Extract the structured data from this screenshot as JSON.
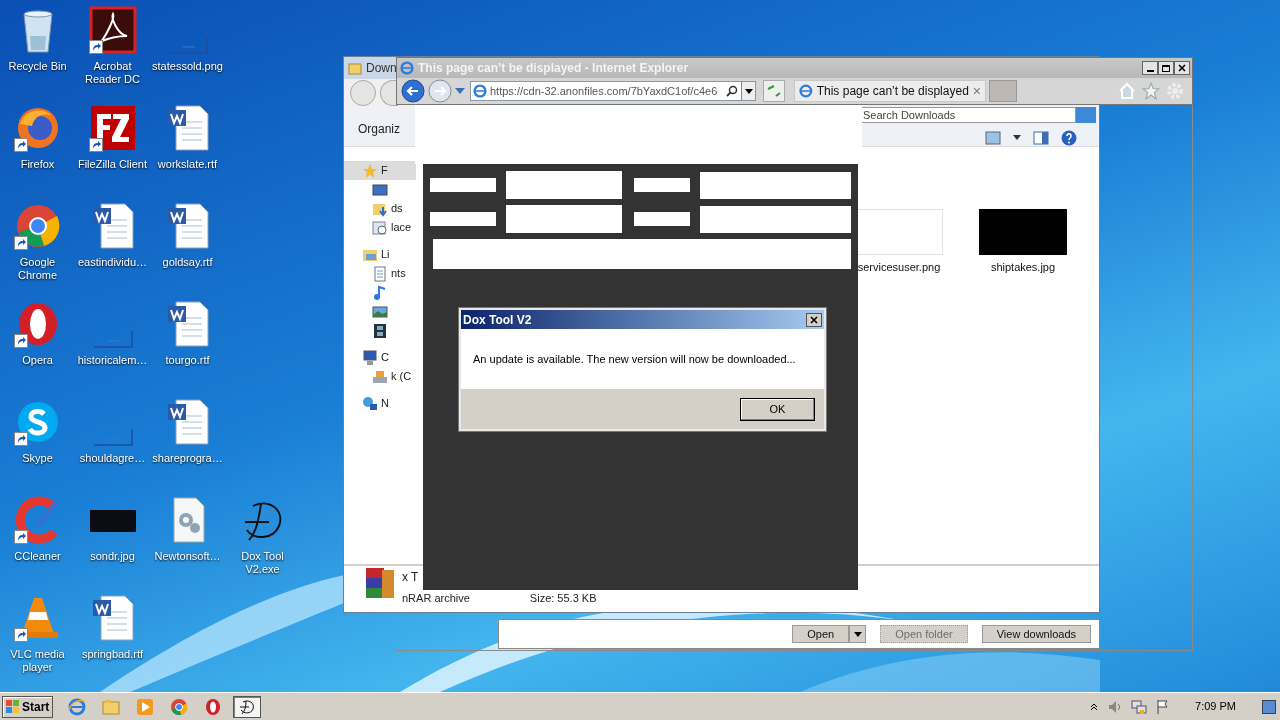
{
  "desktop_columns": [
    [
      {
        "label": "Recycle Bin",
        "kind": "recycle",
        "shortcut": false
      },
      {
        "label": "Firefox",
        "kind": "firefox",
        "shortcut": true
      },
      {
        "label": "Google Chrome",
        "kind": "chrome",
        "shortcut": true
      },
      {
        "label": "Opera",
        "kind": "opera",
        "shortcut": true
      },
      {
        "label": "Skype",
        "kind": "skype",
        "shortcut": true
      },
      {
        "label": "CCleaner",
        "kind": "ccleaner",
        "shortcut": true
      },
      {
        "label": "VLC media player",
        "kind": "vlc",
        "shortcut": true
      }
    ],
    [
      {
        "label": "Acrobat Reader DC",
        "kind": "acrobat",
        "shortcut": true
      },
      {
        "label": "FileZilla Client",
        "kind": "filezilla",
        "shortcut": true
      },
      {
        "label": "eastindividu…",
        "kind": "word",
        "shortcut": false
      },
      {
        "label": "historicalem…",
        "kind": "blank-image",
        "shortcut": false
      },
      {
        "label": "shouldagre…",
        "kind": "blank-image",
        "shortcut": false
      },
      {
        "label": "sondr.jpg",
        "kind": "dark-image",
        "shortcut": false
      },
      {
        "label": "springbad.rtf",
        "kind": "word",
        "shortcut": false
      }
    ],
    [
      {
        "label": "statessold.png",
        "kind": "blank-image",
        "shortcut": false
      },
      {
        "label": "workslate.rtf",
        "kind": "word",
        "shortcut": false
      },
      {
        "label": "goldsay.rtf",
        "kind": "word",
        "shortcut": false
      },
      {
        "label": "tourgo.rtf",
        "kind": "word",
        "shortcut": false
      },
      {
        "label": "shareprogra…",
        "kind": "word",
        "shortcut": false
      },
      {
        "label": "Newtonsoft…",
        "kind": "settings-file",
        "shortcut": false
      }
    ],
    [
      {
        "label": "Dox Tool V2.exe",
        "kind": "dox",
        "shortcut": false
      }
    ]
  ],
  "explorer": {
    "title": "Down",
    "toolbar_label": "Organiz",
    "search_placeholder": "Search Downloads",
    "nav": [
      {
        "label": "F",
        "kind": "star",
        "selected": true,
        "children": [
          {
            "kind": "desktop",
            "selected": false
          },
          {
            "label": "ds",
            "kind": "downloads",
            "selected": false
          },
          {
            "label": "lace",
            "kind": "recent",
            "selected": false
          }
        ]
      },
      {
        "label": "Li",
        "kind": "library",
        "selected": false,
        "children": [
          {
            "label": "nts",
            "kind": "document",
            "selected": false
          },
          {
            "kind": "music",
            "selected": false
          },
          {
            "kind": "pictures",
            "selected": false
          },
          {
            "kind": "videos",
            "selected": false
          }
        ]
      },
      {
        "label": "C",
        "kind": "computer",
        "selected": false,
        "children": [
          {
            "label": "k (C",
            "kind": "disk",
            "selected": false
          }
        ]
      },
      {
        "label": "N",
        "kind": "network",
        "selected": false
      }
    ],
    "files": [
      {
        "name": "servicesuser.png",
        "kind": "light"
      },
      {
        "name": "shiptakes.jpg",
        "kind": "dark"
      }
    ],
    "details": {
      "name": "x T",
      "type": "nRAR archive",
      "size": "Size: 55.3 KB"
    }
  },
  "browser": {
    "title": "This page can’t be displayed - Internet Explorer",
    "address": "https://cdn-32.anonfiles.com/7bYaxdC1of/c4e6",
    "tab": "This page can’t be displayed",
    "tab_close": "×",
    "download_buttons": [
      {
        "label": "Open",
        "kind": "split",
        "disabled": false
      },
      {
        "label": "Open folder",
        "kind": "plain",
        "disabled": true
      },
      {
        "label": "View downloads",
        "kind": "plain",
        "disabled": false
      }
    ]
  },
  "dialog": {
    "title": "Dox Tool V2",
    "message": "An update is available. The new version will now be downloaded...",
    "button": "OK"
  },
  "taskbar": {
    "start": "Start",
    "apps": [
      {
        "kind": "ie",
        "selected": false
      },
      {
        "kind": "explorer",
        "selected": false
      },
      {
        "kind": "media",
        "selected": false
      },
      {
        "kind": "chrome",
        "selected": false
      },
      {
        "kind": "opera",
        "selected": false
      },
      {
        "kind": "dox",
        "selected": true
      }
    ],
    "clock": "7:09 PM"
  }
}
